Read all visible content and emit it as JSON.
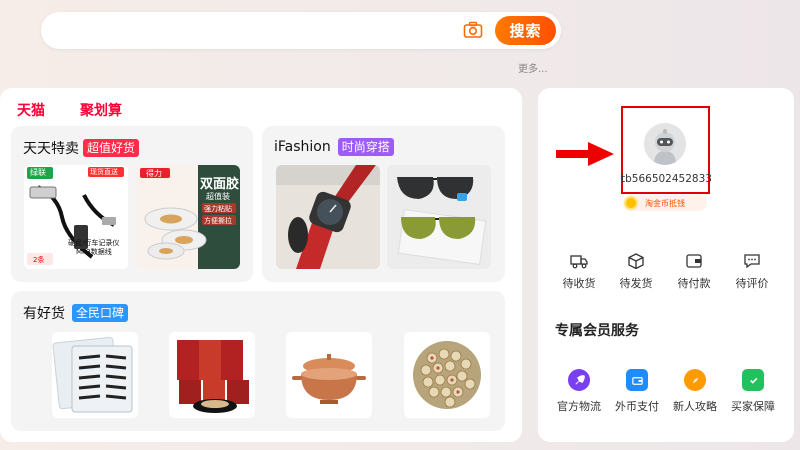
{
  "search": {
    "button_label": "搜索",
    "more_label": "更多..."
  },
  "nav": {
    "tabs": [
      {
        "label": "天猫"
      },
      {
        "label": "聚划算"
      }
    ]
  },
  "cards": {
    "daily_deals": {
      "title": "天天特卖",
      "badge": "超值好货",
      "products": [
        {
          "brand": "绿联",
          "tag": "现货直送",
          "caption_line1": "硬盘/行车记录仪",
          "caption_line2": "MP3数据线",
          "qty": "2条"
        },
        {
          "brand": "得力",
          "title": "双面胶",
          "subtitle": "超值装",
          "note1": "强力粘贴",
          "note2": "方便撕拉"
        }
      ]
    },
    "ifashion": {
      "title": "iFashion",
      "badge": "时尚穿搭",
      "products": [
        {
          "name": "wristwatch"
        },
        {
          "name": "sunglasses"
        }
      ]
    },
    "good_goods": {
      "title": "有好货",
      "badge": "全民口碑",
      "products": [
        {
          "name": "false-eyelashes"
        },
        {
          "name": "tea-packages"
        },
        {
          "name": "copper-pot"
        },
        {
          "name": "lotus-seeds"
        }
      ]
    }
  },
  "user": {
    "username": "tb566502452833",
    "coin_label": "淘金币抵钱",
    "orders": [
      {
        "label": "待收货",
        "icon": "truck-icon"
      },
      {
        "label": "待发货",
        "icon": "box-icon"
      },
      {
        "label": "待付款",
        "icon": "wallet-icon"
      },
      {
        "label": "待评价",
        "icon": "chat-icon"
      }
    ],
    "service_title": "专属会员服务",
    "services": [
      {
        "label": "官方物流",
        "icon": "rocket-icon",
        "color": "#7b3ff2"
      },
      {
        "label": "外币支付",
        "icon": "currency-icon",
        "color": "#1e8cff"
      },
      {
        "label": "新人攻略",
        "icon": "compass-icon",
        "color": "#ff9a00"
      },
      {
        "label": "买家保障",
        "icon": "shield-icon",
        "color": "#22c15e"
      }
    ]
  },
  "colors": {
    "accent": "#ff5000",
    "tmall_red": "#ff0036",
    "annotation_red": "#e00000"
  }
}
